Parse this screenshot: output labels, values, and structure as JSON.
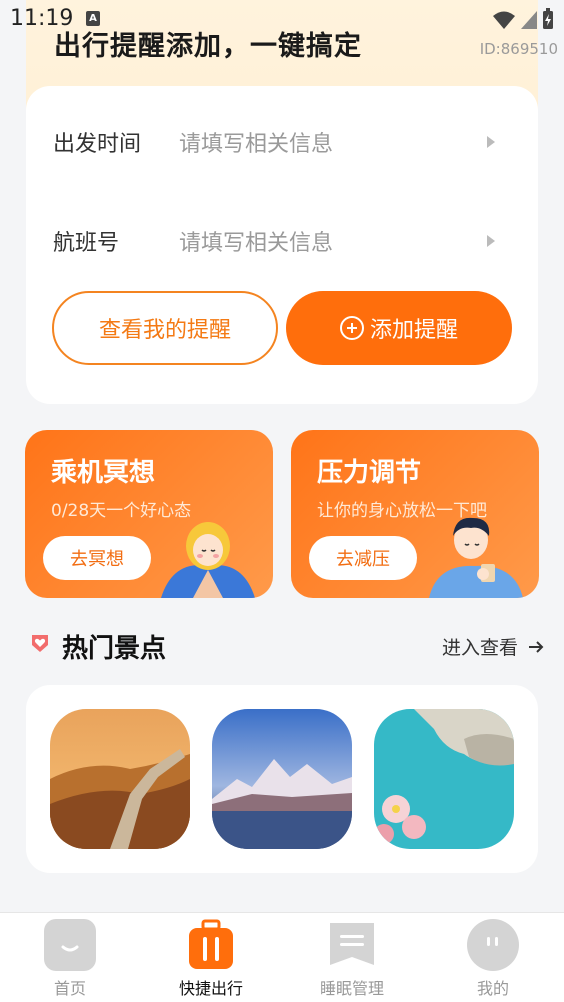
{
  "status_bar": {
    "time": "11:19",
    "a_badge": "A"
  },
  "banner": {
    "title": "出行提醒添加，一键搞定",
    "id_tag": "ID:869510"
  },
  "form": {
    "rows": [
      {
        "label": "出发时间",
        "placeholder": "请填写相关信息"
      },
      {
        "label": "航班号",
        "placeholder": "请填写相关信息"
      }
    ],
    "view_button": "查看我的提醒",
    "add_button": "添加提醒"
  },
  "promos": [
    {
      "title": "乘机冥想",
      "subtitle": "0/28天一个好心态",
      "button": "去冥想"
    },
    {
      "title": "压力调节",
      "subtitle": "让你的身心放松一下吧",
      "button": "去减压"
    }
  ],
  "section": {
    "title": "热门景点",
    "more": "进入查看"
  },
  "tabbar": {
    "items": [
      {
        "label": "首页",
        "icon": "home-icon",
        "active": false
      },
      {
        "label": "快捷出行",
        "icon": "suitcase-icon",
        "active": true
      },
      {
        "label": "睡眠管理",
        "icon": "bookmark-icon",
        "active": false
      },
      {
        "label": "我的",
        "icon": "profile-icon",
        "active": false
      }
    ]
  },
  "colors": {
    "accent": "#ff6e0c",
    "banner_bg": "#fff3dd",
    "page_bg": "#f4f5f7"
  }
}
